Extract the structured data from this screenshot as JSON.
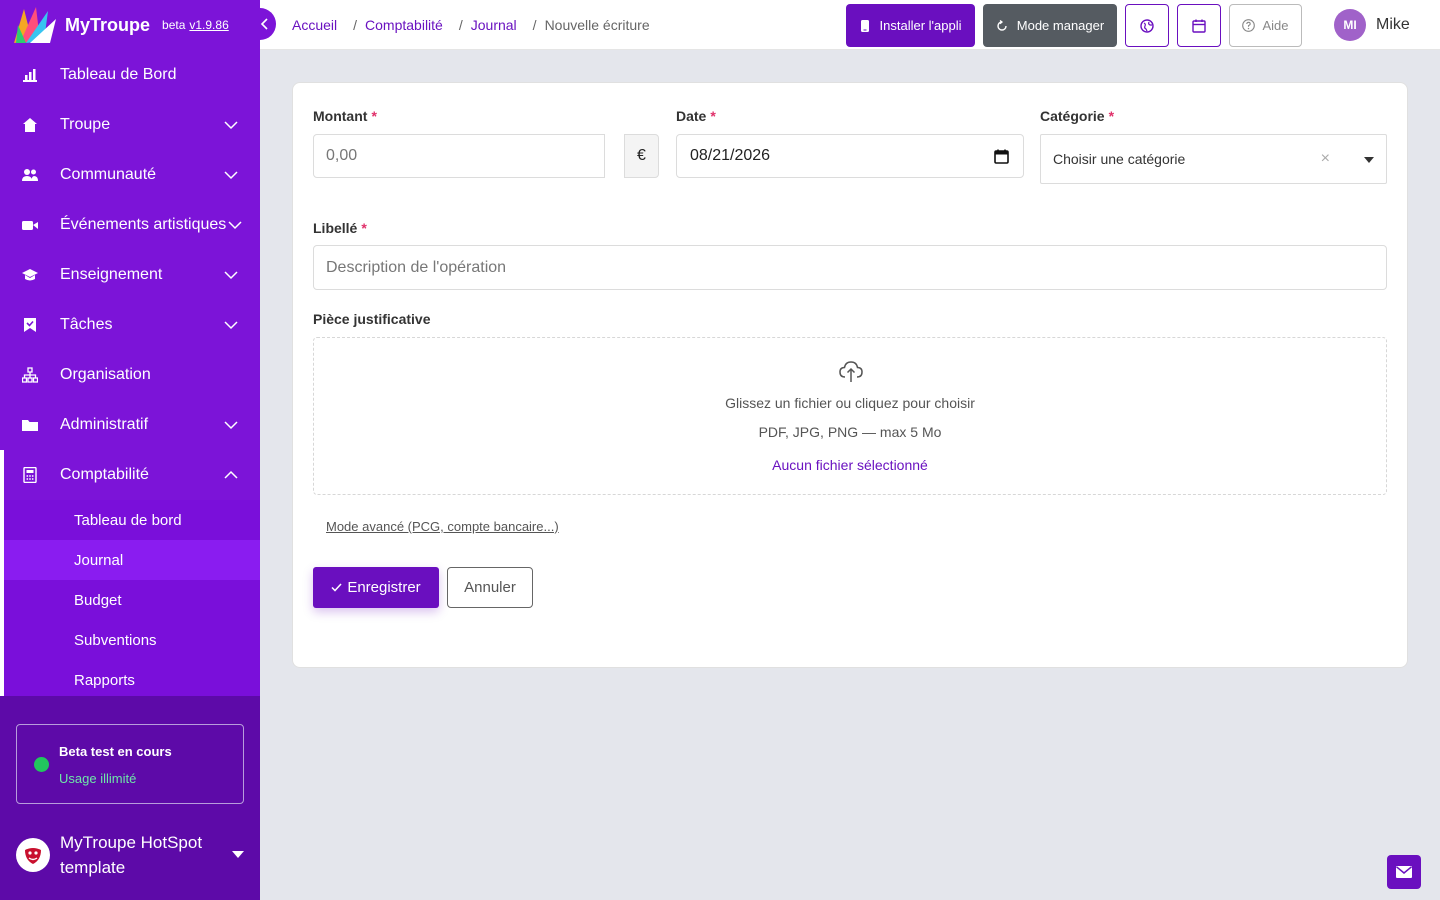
{
  "brand": {
    "name": "MyTroupe",
    "beta": "beta",
    "version": "v1.9.86"
  },
  "sidebar": {
    "items": [
      {
        "label": "Tableau de Bord",
        "icon": "bar-chart-icon",
        "expandable": false
      },
      {
        "label": "Troupe",
        "icon": "home-icon",
        "expandable": true
      },
      {
        "label": "Communauté",
        "icon": "users-icon",
        "expandable": true
      },
      {
        "label": "Événements artistiques",
        "icon": "video-camera-icon",
        "expandable": true
      },
      {
        "label": "Enseignement",
        "icon": "graduation-cap-icon",
        "expandable": true
      },
      {
        "label": "Tâches",
        "icon": "bookmark-check-icon",
        "expandable": true
      },
      {
        "label": "Organisation",
        "icon": "sitemap-icon",
        "expandable": false
      },
      {
        "label": "Administratif",
        "icon": "folder-icon",
        "expandable": true
      }
    ],
    "expanded": {
      "label": "Comptabilité",
      "icon": "calculator-icon",
      "children": [
        {
          "label": "Tableau de bord",
          "active": false
        },
        {
          "label": "Journal",
          "active": true
        },
        {
          "label": "Budget",
          "active": false
        },
        {
          "label": "Subventions",
          "active": false
        },
        {
          "label": "Rapports",
          "active": false
        }
      ]
    },
    "beta_box": {
      "title": "Beta test en cours",
      "subtitle": "Usage illimité"
    },
    "org": {
      "name": "MyTroupe HotSpot template"
    }
  },
  "header": {
    "breadcrumb": [
      "Accueil",
      "Comptabilité",
      "Journal"
    ],
    "breadcrumb_current": "Nouvelle écriture",
    "install_label": "Installer l'appli",
    "manager_label": "Mode manager",
    "help_label": "Aide",
    "user": {
      "initials": "MI",
      "name": "Mike"
    }
  },
  "form": {
    "amount": {
      "label": "Montant",
      "placeholder": "0,00",
      "currency": "€"
    },
    "date": {
      "label": "Date",
      "value": "08/21/2026"
    },
    "category": {
      "label": "Catégorie",
      "placeholder": "Choisir une catégorie",
      "clear": "×"
    },
    "libelle": {
      "label": "Libellé",
      "placeholder": "Description de l'opération"
    },
    "attachment": {
      "label": "Pièce justificative",
      "drop_text": "Glissez un fichier ou cliquez pour choisir",
      "formats": "PDF, JPG, PNG — max 5 Mo",
      "no_file": "Aucun fichier sélectionné"
    },
    "advanced_link": "Mode avancé (PCG, compte bancaire...)",
    "save_label": "Enregistrer",
    "cancel_label": "Annuler",
    "required_mark": "*"
  },
  "colors": {
    "primary": "#7c14d8",
    "accent": "#6a0fbf",
    "sidebar_bottom": "#5d0aa8",
    "required": "#e0306a"
  }
}
